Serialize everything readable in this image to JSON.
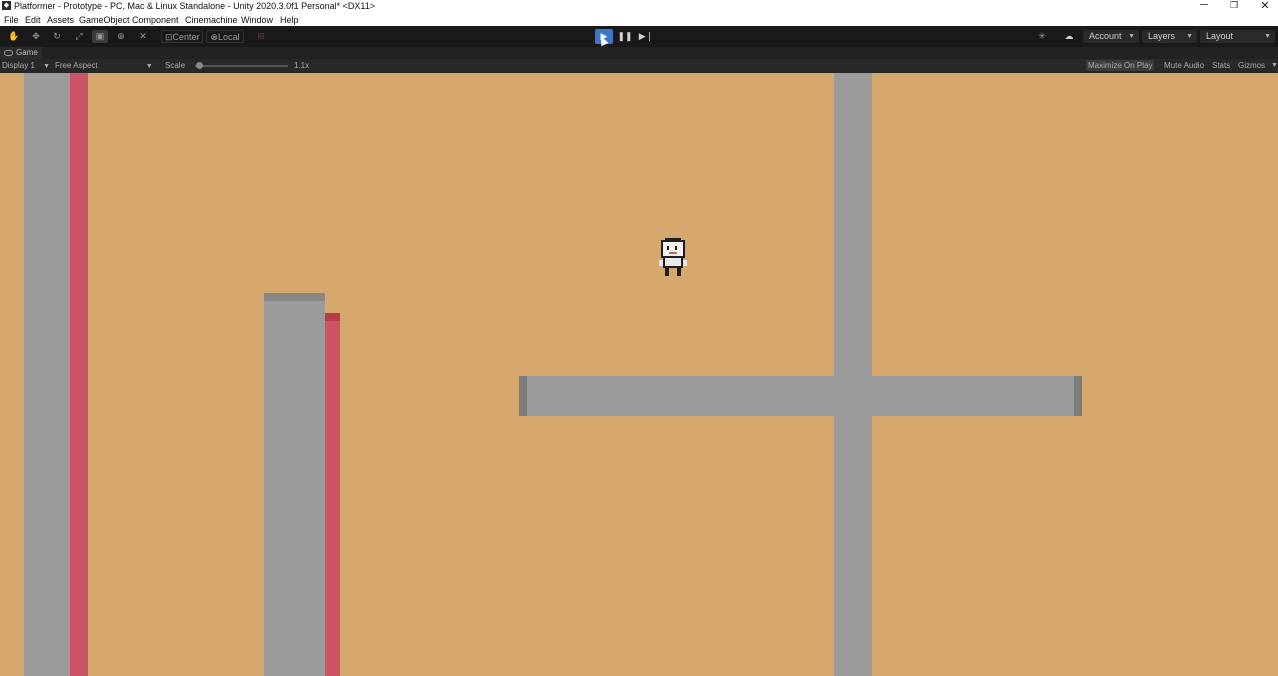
{
  "window": {
    "title": "Platformer - Prototype - PC, Mac & Linux Standalone - Unity 2020.3.0f1 Personal* <DX11>",
    "controls": {
      "minimize": "─",
      "restore": "❐",
      "close": "✕"
    }
  },
  "menu": {
    "items": [
      "File",
      "Edit",
      "Assets",
      "GameObject",
      "Component",
      "Cinemachine",
      "Window",
      "Help"
    ]
  },
  "toolbar": {
    "tools": [
      "hand-tool",
      "move-tool",
      "rotate-tool",
      "scale-tool",
      "rect-tool",
      "transform-tool",
      "custom-tool"
    ],
    "active_tool": "rect-tool",
    "pivot_label": "Center",
    "space_label": "Local",
    "account_label": "Account",
    "layers_label": "Layers",
    "layout_label": "Layout",
    "play_state": "playing"
  },
  "game_tab": {
    "label": "Game"
  },
  "game_toolbar": {
    "display": "Display 1",
    "aspect": "Free Aspect",
    "scale_label": "Scale",
    "scale_value": "1.1x",
    "scale_fraction": 0.05,
    "buttons": [
      {
        "label": "Maximize On Play",
        "active": true
      },
      {
        "label": "Mute Audio",
        "active": false
      },
      {
        "label": "Stats",
        "active": false
      },
      {
        "label": "Gizmos",
        "active": false
      }
    ]
  },
  "colors": {
    "background": "#d6a86d",
    "wall": "#9b9b9b",
    "hazard": "#cc5466",
    "play_button": "#3a78c4"
  },
  "scene": {
    "objects": [
      "wall",
      "spike-wall",
      "pillar",
      "spike-pillar",
      "platform",
      "player"
    ]
  }
}
